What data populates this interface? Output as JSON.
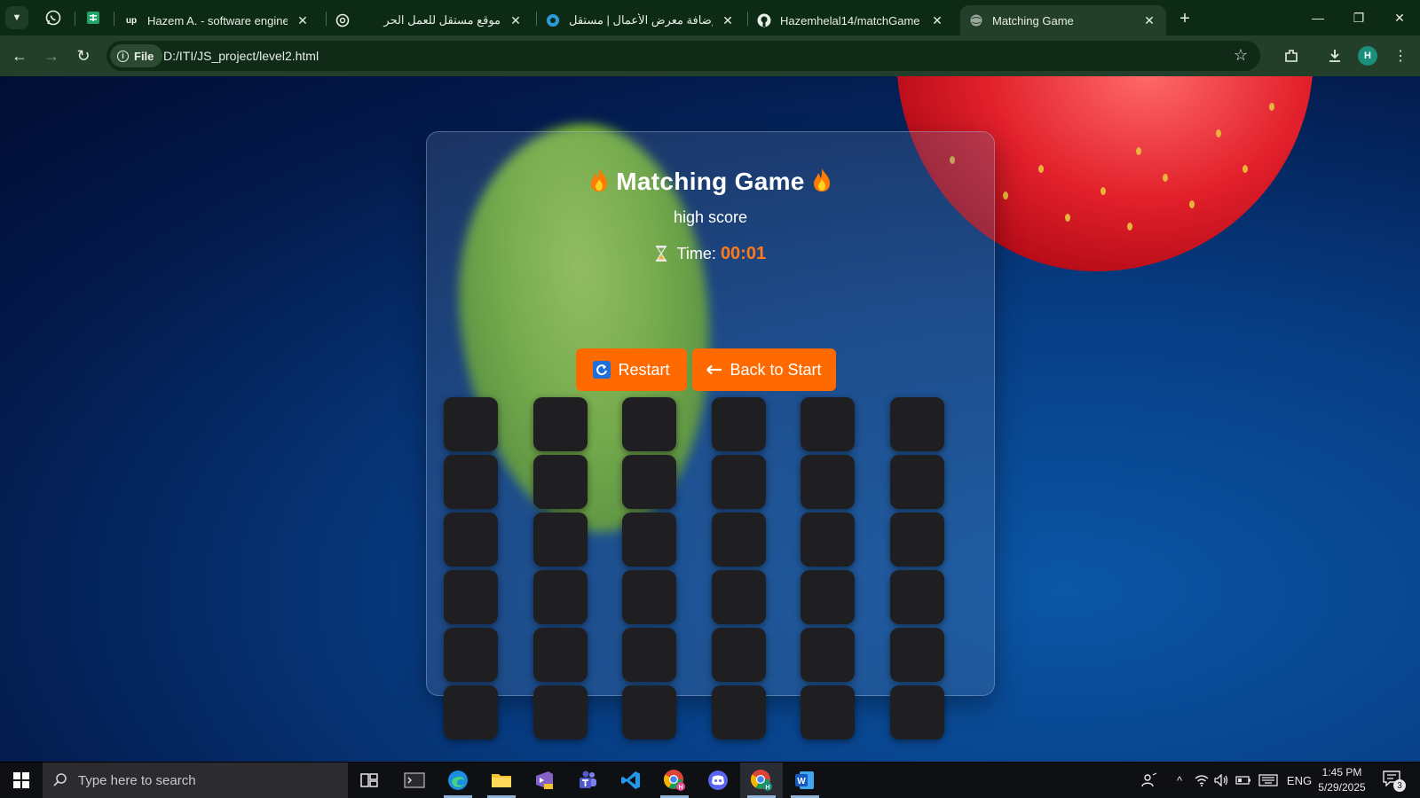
{
  "browser": {
    "tabs": [
      {
        "title": "Hazem A. - software engineerin",
        "icon": "upwork-icon"
      },
      {
        "title": "موقع مستقل للعمل الحر",
        "icon": "openai-icon"
      },
      {
        "title": "إضافة معرض الأعمال | مستقل",
        "icon": "mostaql-icon"
      },
      {
        "title": "Hazemhelal14/matchGame",
        "icon": "github-icon"
      },
      {
        "title": "Matching Game",
        "icon": "globe-icon"
      }
    ],
    "address": {
      "chip_label": "File",
      "url": "D:/ITI/JS_project/level2.html"
    },
    "profile_initial": "H"
  },
  "game": {
    "title": "Matching Game",
    "subtitle": "high score",
    "timer_label": "Time:",
    "timer_value": "00:01",
    "restart_label": "Restart",
    "back_label": "Back to Start",
    "grid_rows": 6,
    "grid_cols": 6,
    "accent_color": "#ff6a00",
    "card_color": "#1f1f21"
  },
  "taskbar": {
    "search_placeholder": "Type here to search",
    "apps": [
      "terminal",
      "edge",
      "file-explorer",
      "visual-studio",
      "teams",
      "vscode",
      "chrome",
      "discord",
      "chrome-active",
      "word"
    ],
    "language": "ENG",
    "time": "1:45 PM",
    "date": "5/29/2025",
    "notification_count": "3"
  }
}
